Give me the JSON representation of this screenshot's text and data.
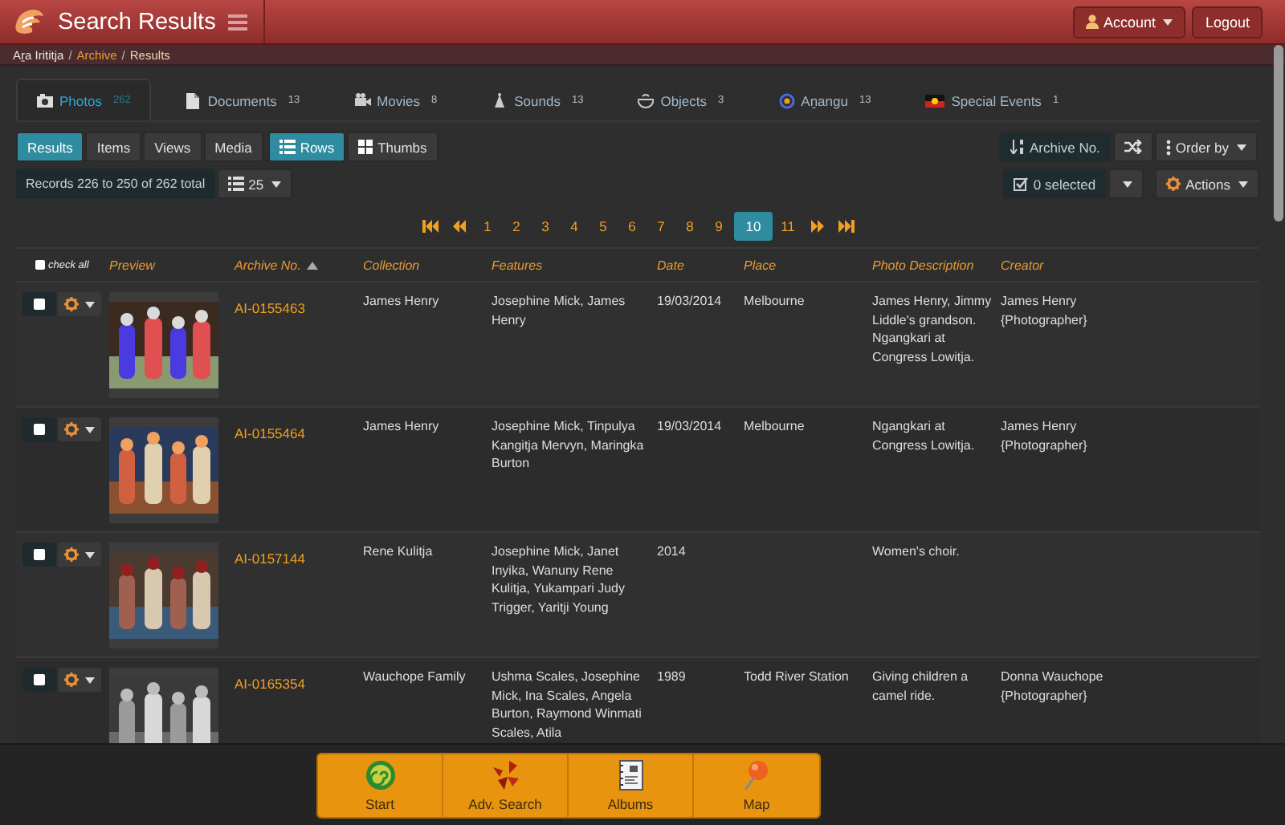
{
  "header": {
    "title": "Search Results",
    "account": "Account",
    "logout": "Logout"
  },
  "breadcrumbs": [
    {
      "label": "Aṟa Irititja",
      "kind": "root"
    },
    {
      "label": "Archive",
      "kind": "link",
      "separator": "/"
    },
    {
      "label": "Results",
      "kind": "current",
      "separator": "/"
    }
  ],
  "tabs": [
    {
      "label": "Photos",
      "count": "262",
      "selected": true
    },
    {
      "label": "Documents",
      "count": "13",
      "selected": false
    },
    {
      "label": "Movies",
      "count": "8",
      "selected": false
    },
    {
      "label": "Sounds",
      "count": "13",
      "selected": false
    },
    {
      "label": "Objects",
      "count": "3",
      "selected": false
    },
    {
      "label": "Aṉangu",
      "count": "13",
      "selected": false
    },
    {
      "label": "Special Events",
      "count": "1",
      "selected": false
    }
  ],
  "view_buttons": [
    {
      "label": "Results",
      "selected": true
    },
    {
      "label": "Items",
      "selected": false
    },
    {
      "label": "Views",
      "selected": false
    },
    {
      "label": "Media",
      "selected": false
    }
  ],
  "layout_buttons": [
    {
      "label": "Rows",
      "selected": true
    },
    {
      "label": "Thumbs",
      "selected": false
    }
  ],
  "records": "Records 226 to 250 of 262 total",
  "per_page": "25",
  "sort_field": "Archive No.",
  "order_by": "Order by",
  "selection": "0 selected",
  "actions": "Actions",
  "pagination": {
    "pages": [
      {
        "label": "1",
        "selected": false
      },
      {
        "label": "2",
        "selected": false
      },
      {
        "label": "3",
        "selected": false
      },
      {
        "label": "4",
        "selected": false
      },
      {
        "label": "5",
        "selected": false
      },
      {
        "label": "6",
        "selected": false
      },
      {
        "label": "7",
        "selected": false
      },
      {
        "label": "8",
        "selected": false
      },
      {
        "label": "9",
        "selected": false
      },
      {
        "label": "10",
        "selected": true
      },
      {
        "label": "11",
        "selected": false
      }
    ]
  },
  "table": {
    "check_all": {
      "label": "check all",
      "checked": false
    },
    "columns": [
      {
        "label": "Preview",
        "sorted": false
      },
      {
        "label": "Archive No.",
        "sorted": true
      },
      {
        "label": "Collection",
        "sorted": false
      },
      {
        "label": "Features",
        "sorted": false
      },
      {
        "label": "Date",
        "sorted": false
      },
      {
        "label": "Place",
        "sorted": false
      },
      {
        "label": "Photo Description",
        "sorted": false
      },
      {
        "label": "Creator",
        "sorted": false
      }
    ],
    "rows": [
      {
        "checked": false,
        "archive_no": "AI-0155463",
        "collection": "James Henry",
        "features": "Josephine Mick, James Henry",
        "date": "19/03/2014",
        "place": "Melbourne",
        "description": "James Henry, Jimmy Liddle's grandson. Ngangkari at Congress Lowitja.",
        "creator": "James Henry {Photographer}"
      },
      {
        "checked": false,
        "archive_no": "AI-0155464",
        "collection": "James Henry",
        "features": "Josephine Mick, Tinpulya Kangitja Mervyn, Maringka Burton",
        "date": "19/03/2014",
        "place": "Melbourne",
        "description": "Ngangkari at Congress Lowitja.",
        "creator": "James Henry {Photographer}"
      },
      {
        "checked": false,
        "archive_no": "AI-0157144",
        "collection": "Rene Kulitja",
        "features": "Josephine Mick, Janet Inyika, Wanuny Rene Kulitja, Yukampari Judy Trigger, Yaritji Young",
        "date": "2014",
        "description": "Women's choir."
      },
      {
        "checked": false,
        "archive_no": "AI-0165354",
        "collection": "Wauchope Family",
        "features": "Ushma Scales, Josephine Mick, Ina Scales, Angela Burton, Raymond Winmati Scales, Atila",
        "date": "1989",
        "place": "Todd River Station",
        "description": "Giving children a camel ride.",
        "creator": "Donna Wauchope {Photographer}"
      }
    ]
  },
  "footer_buttons": [
    {
      "label": "Start"
    },
    {
      "label": "Adv. Search"
    },
    {
      "label": "Albums"
    },
    {
      "label": "Map"
    }
  ]
}
